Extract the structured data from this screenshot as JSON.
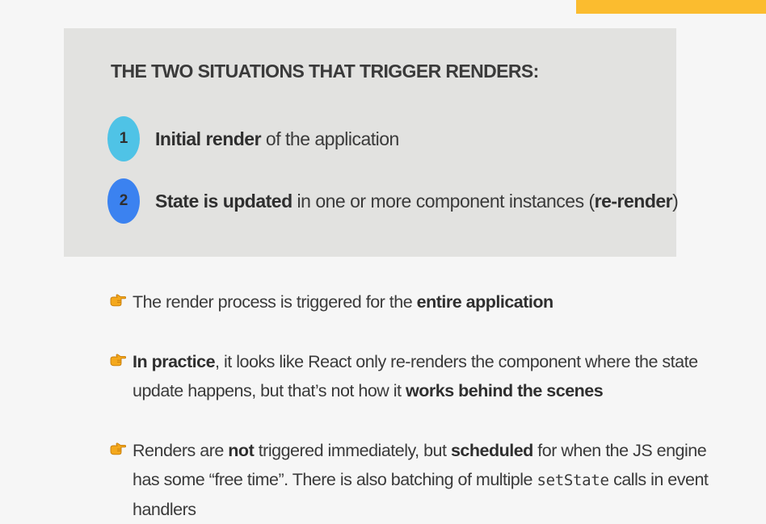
{
  "panel": {
    "title": "THE TWO SITUATIONS THAT TRIGGER RENDERS:",
    "items": [
      {
        "number": "1",
        "bold": "Initial render",
        "text": " of the application",
        "color": "#4fc3e6"
      },
      {
        "number": "2",
        "bold": "State is updated",
        "text": " in one or more component instances (",
        "bold2": "re-render",
        "text2": ")",
        "color": "#3b82f0"
      }
    ]
  },
  "bullets": [
    {
      "icon": "pointing-hand-icon",
      "text1": "The render process is triggered for the ",
      "bold1": "entire application"
    },
    {
      "icon": "pointing-hand-icon",
      "bold1": "In practice",
      "text1": ", it looks like React only re-renders the component where the state update happens, but that’s not how it ",
      "bold2": "works behind the scenes"
    },
    {
      "icon": "pointing-hand-icon",
      "text1": "Renders are ",
      "bold1": "not",
      "text2": " triggered immediately, but ",
      "bold2": "scheduled",
      "text3": " for when the JS engine has some “free time”. There is also batching of multiple ",
      "code": "setState",
      "text4": " calls in event handlers"
    }
  ],
  "colors": {
    "accent": "#fbbc2f",
    "panel_bg": "#e2e2e0",
    "page_bg": "#f6f6f6"
  }
}
